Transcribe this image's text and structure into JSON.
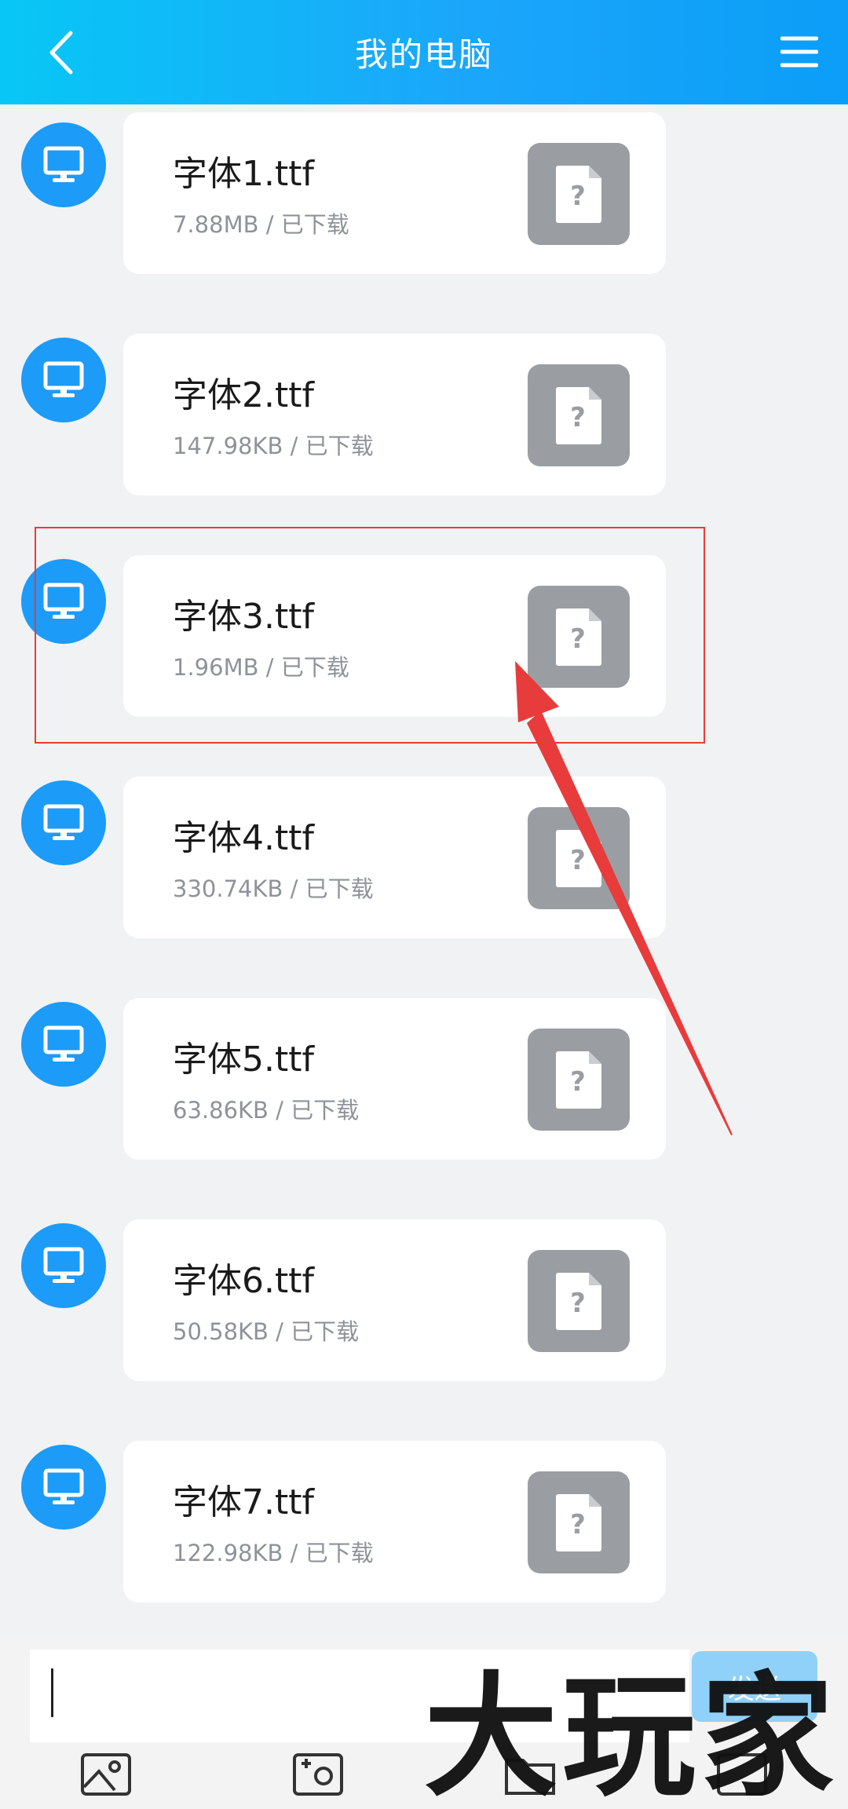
{
  "header": {
    "title": "我的电脑",
    "back_icon": "chevron-left-icon",
    "menu_icon": "hamburger-menu-icon"
  },
  "files": [
    {
      "name": "字体1.ttf",
      "meta": "7.88MB / 已下载"
    },
    {
      "name": "字体2.ttf",
      "meta": "147.98KB / 已下载"
    },
    {
      "name": "字体3.ttf",
      "meta": "1.96MB / 已下载"
    },
    {
      "name": "字体4.ttf",
      "meta": "330.74KB / 已下载"
    },
    {
      "name": "字体5.ttf",
      "meta": "63.86KB / 已下载"
    },
    {
      "name": "字体6.ttf",
      "meta": "50.58KB / 已下载"
    },
    {
      "name": "字体7.ttf",
      "meta": "122.98KB / 已下载"
    }
  ],
  "input": {
    "value": "",
    "send_label": "发送"
  },
  "toolbar": {
    "icons": [
      "image-icon",
      "camera-icon",
      "folder-icon",
      "screen-icon"
    ]
  },
  "watermark": "大玩家",
  "colors": {
    "header_start": "#08C7F6",
    "header_end": "#0B9EF8",
    "avatar_blue": "#1C9BF8",
    "file_icon_gray": "#9A9EA3",
    "annotation_red": "#E83B3B",
    "send_button": "#8FD1F8"
  }
}
